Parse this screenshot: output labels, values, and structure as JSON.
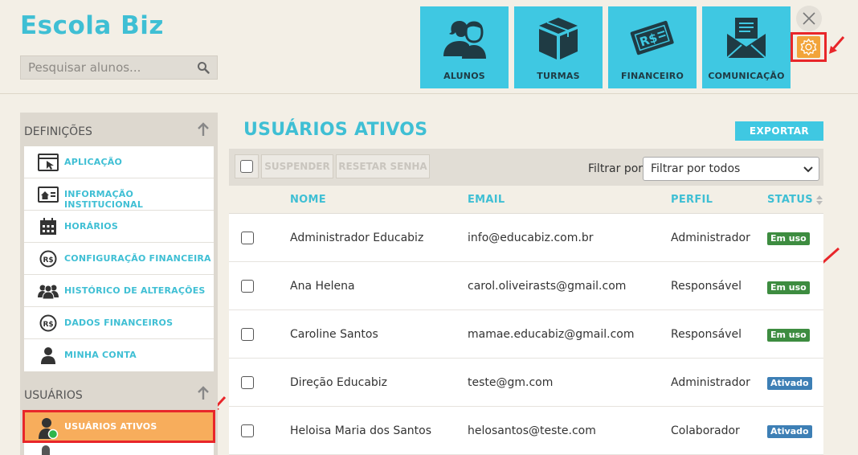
{
  "app": {
    "brand": "Escola Biz"
  },
  "search": {
    "placeholder": "Pesquisar alunos..."
  },
  "nav_tiles": [
    {
      "label": "ALUNOS",
      "icon": "students-icon"
    },
    {
      "label": "TURMAS",
      "icon": "box-icon"
    },
    {
      "label": "FINANCEIRO",
      "icon": "money-icon"
    },
    {
      "label": "COMUNICAÇÃO",
      "icon": "envelope-icon"
    }
  ],
  "sidebar": {
    "definitions_title": "DEFINIÇÕES",
    "definitions": [
      {
        "label": "APLICAÇÃO",
        "icon": "window-cursor-icon"
      },
      {
        "label": "INFORMAÇÃO INSTITUCIONAL",
        "icon": "home-card-icon"
      },
      {
        "label": "HORÁRIOS",
        "icon": "calendar-icon"
      },
      {
        "label": "CONFIGURAÇÃO FINANCEIRA",
        "icon": "currency-icon"
      },
      {
        "label": "HISTÓRICO DE ALTERAÇÕES",
        "icon": "group-icon"
      },
      {
        "label": "DADOS FINANCEIROS",
        "icon": "currency-icon"
      },
      {
        "label": "MINHA CONTA",
        "icon": "user-icon"
      }
    ],
    "users_title": "USUÁRIOS",
    "users": [
      {
        "label": "USUÁRIOS ATIVOS",
        "icon": "user-online-icon"
      }
    ]
  },
  "main": {
    "title": "USUÁRIOS ATIVOS",
    "export_label": "EXPORTAR",
    "toolbar": {
      "suspend_label": "SUSPENDER",
      "reset_label": "RESETAR SENHA",
      "filter_label": "Filtrar por",
      "filter_value": "Filtrar por todos"
    },
    "columns": {
      "name": "NOME",
      "email": "EMAIL",
      "profile": "PERFIL",
      "status": "STATUS"
    },
    "rows": [
      {
        "name": "Administrador Educabiz",
        "email": "info@educabiz.com.br",
        "profile": "Administrador",
        "status": "Em uso"
      },
      {
        "name": "Ana Helena",
        "email": "carol.oliveirasts@gmail.com",
        "profile": "Responsável",
        "status": "Em uso"
      },
      {
        "name": "Caroline Santos",
        "email": "mamae.educabiz@gmail.com",
        "profile": "Responsável",
        "status": "Em uso"
      },
      {
        "name": "Direção Educabiz",
        "email": "teste@gm.com",
        "profile": "Administrador",
        "status": "Ativado"
      },
      {
        "name": "Heloisa Maria dos Santos",
        "email": "helosantos@teste.com",
        "profile": "Colaborador",
        "status": "Ativado"
      }
    ]
  },
  "colors": {
    "accent": "#3fc8e2",
    "highlight": "#e8262a",
    "active_item": "#f7ad5c",
    "badge_in_use": "#3d8c40",
    "badge_active": "#3d7fb5"
  }
}
